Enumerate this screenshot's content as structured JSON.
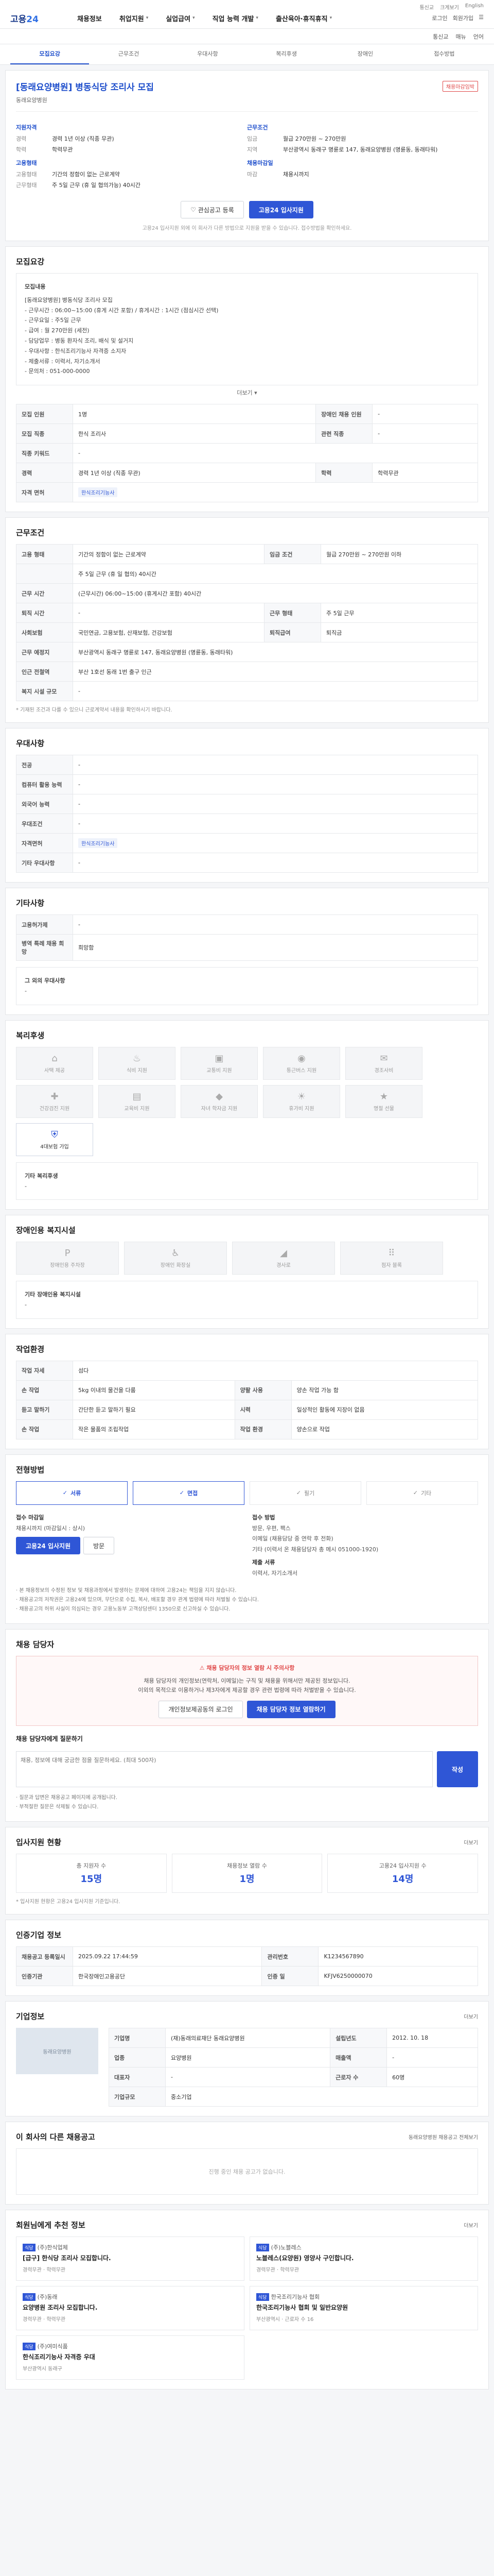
{
  "topbar": {
    "logo_prefix": "고용",
    "logo_num": "24",
    "nav": [
      "채용정보",
      "취업지원",
      "실업급여",
      "직업 능력 개발",
      "출산육아·휴직휴직"
    ],
    "right": [
      "로그인",
      "회원가입"
    ],
    "utility": [
      "통신교",
      "크게보기",
      "English"
    ]
  },
  "subbar": [
    "통신교",
    "매뉴",
    "언어"
  ],
  "tabs": [
    "모집요강",
    "근무조건",
    "우대사항",
    "복리후생",
    "장애인",
    "접수방법"
  ],
  "header": {
    "title": "[동래요양병원] 병동식당 조리사 모집",
    "badge": "채용마감임박",
    "subtitle": "동래요양병원",
    "left_group": "지원자격",
    "left_rows": [
      {
        "k": "경력",
        "v": "경력 1년 이상 (직종 무관)"
      },
      {
        "k": "학력",
        "v": "학력무관"
      }
    ],
    "left_group2": "고용형태",
    "left_rows2": [
      {
        "k": "고용형태",
        "v": "기간의 정함이 없는 근로계약"
      },
      {
        "k": "근무형태",
        "v": "주 5일 근무 (휴 일 협의가능) 40시간"
      }
    ],
    "right_group": "근무조건",
    "right_rows": [
      {
        "k": "임금",
        "v": "월급 270만원 ~ 270만원"
      },
      {
        "k": "지역",
        "v": "부산광역시 동래구 명륜로 147, 동래요양병원 (명륜동, 동래타워)"
      }
    ],
    "right_group2": "채용마감일",
    "right_rows2": [
      {
        "k": "마감",
        "v": "채용시까지"
      }
    ],
    "btn_scrap": "관심공고 등록",
    "btn_apply": "고용24 입사지원",
    "notice": "고용24 입사지원 외에 이 회사가 다른 방법으로 지원을 받을 수 있습니다. 접수방법을 확인하세요."
  },
  "recruit": {
    "title": "모집요강",
    "box_title": "모집내용",
    "lines": [
      "[동래요양병원] 병동식당 조리사 모집",
      "- 근무시간 : 06:00~15:00 (휴게 시간 포함) / 휴게시간 : 1시간 (점심시간 선택)",
      "- 근무요일 : 주5일 근무",
      "- 급여 : 월 270만원 (세전)",
      "- 담당업무 : 병동 환자식 조리, 배식 및 설거지",
      "- 우대사항 : 한식조리기능사 자격증 소지자",
      "- 제출서류 : 이력서, 자기소개서",
      "- 문의처 : 051-000-0000"
    ],
    "more": "더보기",
    "rows": [
      [
        {
          "k": "모집 인원",
          "v": "1명"
        },
        {
          "k": "장애인 채용 인원",
          "v": "-"
        }
      ],
      [
        {
          "k": "모집 직종",
          "v": "한식 조리사"
        },
        {
          "k": "관련 직종",
          "v": "-"
        }
      ],
      [
        {
          "k": "직종 키워드",
          "v": "-"
        },
        {
          "k": "",
          "v": ""
        }
      ],
      [
        {
          "k": "경력",
          "v": "경력 1년 이상 (직종 무관)"
        },
        {
          "k": "학력",
          "v": "학력무관"
        }
      ],
      [
        {
          "k": "자격 면허",
          "v": "한식조리기능사"
        },
        {
          "k": "",
          "v": ""
        }
      ]
    ]
  },
  "conditions": {
    "title": "근무조건",
    "rows": [
      [
        {
          "k": "고용 형태",
          "v": "기간의 정함이 없는 근로계약"
        },
        {
          "k": "임금 조건",
          "v": "월급 270만원 ~ 270만원 이하"
        }
      ],
      [
        {
          "k": "",
          "v": "주 5일 근무 (휴 일 협의) 40시간"
        },
        {
          "k": "",
          "v": ""
        }
      ],
      [
        {
          "k": "근무 시간",
          "v": "(근무시간) 06:00~15:00 (휴게시간 포함) 40시간"
        },
        {
          "k": "",
          "v": ""
        }
      ],
      [
        {
          "k": "퇴직 시간",
          "v": "-"
        },
        {
          "k": "근무 형태",
          "v": "주 5일 근무"
        }
      ],
      [
        {
          "k": "사회보험",
          "v": "국민연금, 고용보험, 산재보험, 건강보험"
        },
        {
          "k": "퇴직급여",
          "v": "퇴직금"
        }
      ],
      [
        {
          "k": "근무 예정지",
          "v": "부산광역시 동래구 명륜로 147, 동래요양병원 (명륜동, 동래타워)"
        },
        {
          "k": "",
          "v": ""
        }
      ],
      [
        {
          "k": "인근 전철역",
          "v": "부산 1호선 동래 1번 출구 인근"
        },
        {
          "k": "",
          "v": ""
        }
      ],
      [
        {
          "k": "복지 시설 규모",
          "v": "-"
        },
        {
          "k": "",
          "v": ""
        }
      ]
    ],
    "note": "* 기재된 조건과 다를 수 있으니 근로계약서 내용을 확인하시기 바랍니다."
  },
  "preference": {
    "title": "우대사항",
    "rows": [
      {
        "k": "전공",
        "v": "-"
      },
      {
        "k": "컴퓨터 활용 능력",
        "v": "-"
      },
      {
        "k": "외국어 능력",
        "v": "-"
      },
      {
        "k": "우대조건",
        "v": "-"
      },
      {
        "k": "자격면허",
        "v": "한식조리기능사"
      },
      {
        "k": "기타 우대사항",
        "v": "-"
      }
    ]
  },
  "others": {
    "title": "기타사항",
    "rows": [
      {
        "k": "고용허가제",
        "v": "-"
      },
      {
        "k": "병역 특례 채용 희망",
        "v": "희망함"
      }
    ],
    "extra_title": "그 외의 우대사항",
    "extra_value": "-"
  },
  "welfare": {
    "title": "복리후생",
    "items": [
      {
        "label": "사택 제공",
        "icon": "home-icon",
        "on": false
      },
      {
        "label": "식비 지원",
        "icon": "meal-icon",
        "on": false
      },
      {
        "label": "교통비 지원",
        "icon": "bus-icon",
        "on": false
      },
      {
        "label": "통근버스 지원",
        "icon": "car-icon",
        "on": false
      },
      {
        "label": "경조사비",
        "icon": "gift-icon",
        "on": false
      },
      {
        "label": "건강검진 지원",
        "icon": "health-icon",
        "on": false
      },
      {
        "label": "교육비 지원",
        "icon": "book-icon",
        "on": false
      },
      {
        "label": "자녀 학자금 지원",
        "icon": "cap-icon",
        "on": false
      },
      {
        "label": "휴가비 지원",
        "icon": "beach-icon",
        "on": false
      },
      {
        "label": "명절 선물",
        "icon": "present-icon",
        "on": false
      },
      {
        "label": "4대보험 가입",
        "icon": "shield-icon",
        "on": true
      }
    ],
    "other_title": "기타 복리후생",
    "other_value": "-"
  },
  "disability": {
    "title": "장애인용 복지시설",
    "items": [
      "장애인용 주차장",
      "장애인 화장실",
      "경사로",
      "점자 블록"
    ],
    "other_title": "기타 장애인용 복지시설",
    "other_value": "-"
  },
  "apply_env": {
    "title": "작업환경",
    "rows": [
      [
        {
          "k": "작업 자세",
          "v": "섬다"
        },
        {
          "k": "",
          "v": ""
        }
      ],
      [
        {
          "k": "손 작업",
          "v": "5kg 이내의 물건을 다룸"
        },
        {
          "k": "양팔 사용",
          "v": "양손 작업 가능 함"
        }
      ],
      [
        {
          "k": "듣고 말하기",
          "v": "간단한 듣고 말하기 필요"
        },
        {
          "k": "시력",
          "v": "일상적인 활동에 지장이 없음"
        }
      ],
      [
        {
          "k": "손 작업",
          "v": "작은 물품의 조립작업"
        },
        {
          "k": "작업 환경",
          "v": "양손으로 작업"
        }
      ]
    ]
  },
  "apply_method": {
    "title": "전형방법",
    "choices": [
      "서류",
      "면접",
      "필기",
      "기타"
    ],
    "chosen": [
      true,
      true,
      false,
      false
    ],
    "col1_title": "접수 마감일",
    "col1_lines": [
      "채용시까지 (마감일시 : 상시)"
    ],
    "btn_apply": "고용24 입사지원",
    "btn_visit": "방문",
    "col2_title": "접수 방법",
    "col2_lines": [
      "방문, 우편, 팩스",
      "이메일 (채용담당 중 연락 후 전화)",
      "기타 (이력서 온 채용담당자 총 메시 051000-1920)"
    ],
    "col2_title2": "제출 서류",
    "col2_lines2": [
      "이력서, 자기소개서"
    ],
    "notes": [
      "· 본 채용정보의 수정된 정보 및 채용과정에서 발생하는 문제에 대하여 고용24는 책임을 지지 않습니다.",
      "· 채용공고의 저작권은 고용24에 있으며, 무단으로 수집, 복사, 배포할 경우 관계 법령에 따라 처벌될 수 있습니다.",
      "· 채용공고의 허위 사실이 의심되는 경우 고용노동부 고객상담센터 1350으로 신고하실 수 있습니다."
    ]
  },
  "contact": {
    "title": "채용 담당자",
    "warn_title": "채용 담당자의 정보 열람 시 주의사항",
    "warn_lines": [
      "채용 담당자의 개인정보(연락처, 이메일)는 구직 및 채용을 위해서만 제공된 정보입니다.",
      "이외의 목적으로 이용하거나 제3자에게 제공할 경우 관련 법령에 따라 처벌받을 수 있습니다."
    ],
    "btn_login": "개인정보제공동의 로그인",
    "btn_view": "채용 담당자 정보 열람하기",
    "inq_title": "채용 담당자에게 질문하기",
    "inq_placeholder": "채용, 정보에 대해 궁금한 점을 질문하세요. (최대 500자)",
    "inq_btn": "작성",
    "inq_notes": [
      "· 질문과 답변은 채용공고 페이지에 공개됩니다.",
      "· 부적절한 질문은 삭제될 수 있습니다."
    ]
  },
  "stats": {
    "title": "입사지원 현황",
    "more": "더보기",
    "items": [
      {
        "label": "총 지원자 수",
        "value": "15명"
      },
      {
        "label": "채용정보 열람 수",
        "value": "1명"
      },
      {
        "label": "고용24 입사지원 수",
        "value": "14명"
      }
    ],
    "note": "* 입사지원 현황은 고용24 입사지원 기준입니다."
  },
  "posting_info": {
    "title": "인증기업 정보",
    "rows": [
      [
        {
          "k": "채용공고 등록일시",
          "v": "2025.09.22 17:44:59"
        },
        {
          "k": "관리번호",
          "v": "K1234567890"
        }
      ],
      [
        {
          "k": "인증기관",
          "v": "한국장애인고용공단"
        },
        {
          "k": "인증 일",
          "v": "KFJV6250000070"
        }
      ]
    ]
  },
  "company": {
    "title": "기업정보",
    "more": "더보기",
    "image_label": "동래요양병원",
    "rows": [
      [
        {
          "k": "기업명",
          "v": "(재)동래의료재단 동래요양병원"
        },
        {
          "k": "설립년도",
          "v": "2012. 10. 18"
        }
      ],
      [
        {
          "k": "업종",
          "v": "요양병원"
        },
        {
          "k": "매출액",
          "v": "-"
        }
      ],
      [
        {
          "k": "대표자",
          "v": "-"
        },
        {
          "k": "근로자 수",
          "v": "60명"
        }
      ],
      [
        {
          "k": "기업규모",
          "v": "중소기업"
        },
        {
          "k": "",
          "v": ""
        }
      ]
    ]
  },
  "same_company": {
    "title": "이 회사의 다른 채용공고",
    "more": "동래요양병원 채용공고 전체보기",
    "empty": "진행 중인 채용 공고가 없습니다."
  },
  "recommend": {
    "title": "회원님에게 추천 정보",
    "more": "더보기",
    "items": [
      {
        "tag": "식당",
        "co": "(주)한식업체",
        "title": "[급구] 한식당 조리사 모집합니다.",
        "meta": "경력무관 · 학력무관"
      },
      {
        "tag": "식당",
        "co": "(주)노블레스",
        "title": "노블레스(요양원) 영양사 구인합니다.",
        "meta": "경력무관 · 학력무관"
      },
      {
        "tag": "식당",
        "co": "(주)동래",
        "title": "요양병원 조리사 모집합니다.",
        "meta": "경력무관 · 학력무관"
      },
      {
        "tag": "식당",
        "co": "한국조리기능사 협회",
        "title": "한국조리기능사 협회 및 일반요양원",
        "meta": "부산광역시 · 근로자 수 16"
      },
      {
        "tag": "식당",
        "co": "(주)여미식품",
        "title": "한식조리기능사 자격증 우대",
        "meta": "부산광역시 동래구"
      }
    ]
  }
}
